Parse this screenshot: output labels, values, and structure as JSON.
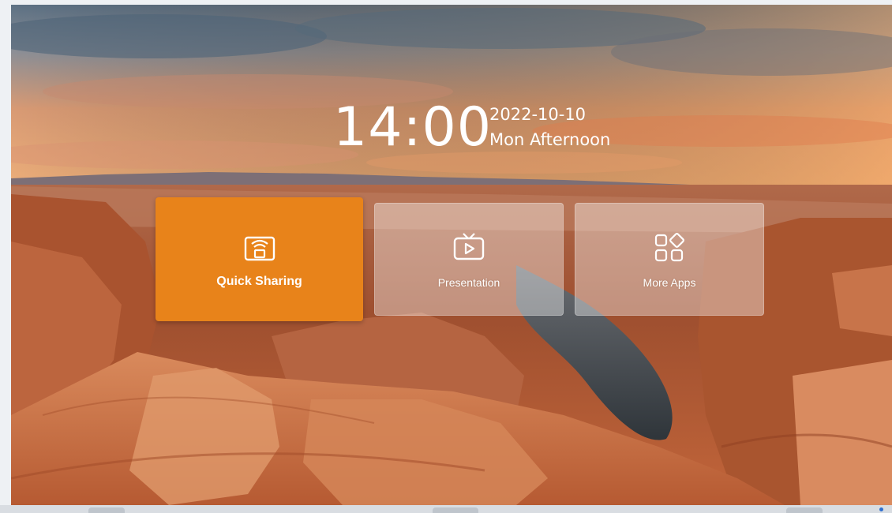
{
  "clock": {
    "time": "14:00",
    "date": "2022-10-10",
    "period": "Mon Afternoon"
  },
  "tiles": [
    {
      "label": "Quick Sharing",
      "icon": "screen-share-icon",
      "active": true
    },
    {
      "label": "Presentation",
      "icon": "tv-play-icon",
      "active": false
    },
    {
      "label": "More Apps",
      "icon": "apps-grid-icon",
      "active": false
    }
  ],
  "colors": {
    "accent": "#e8831a",
    "glass": "rgba(255,255,255,0.38)",
    "text": "#ffffff"
  },
  "background": {
    "description_icon": "canyon-landscape-wallpaper"
  }
}
